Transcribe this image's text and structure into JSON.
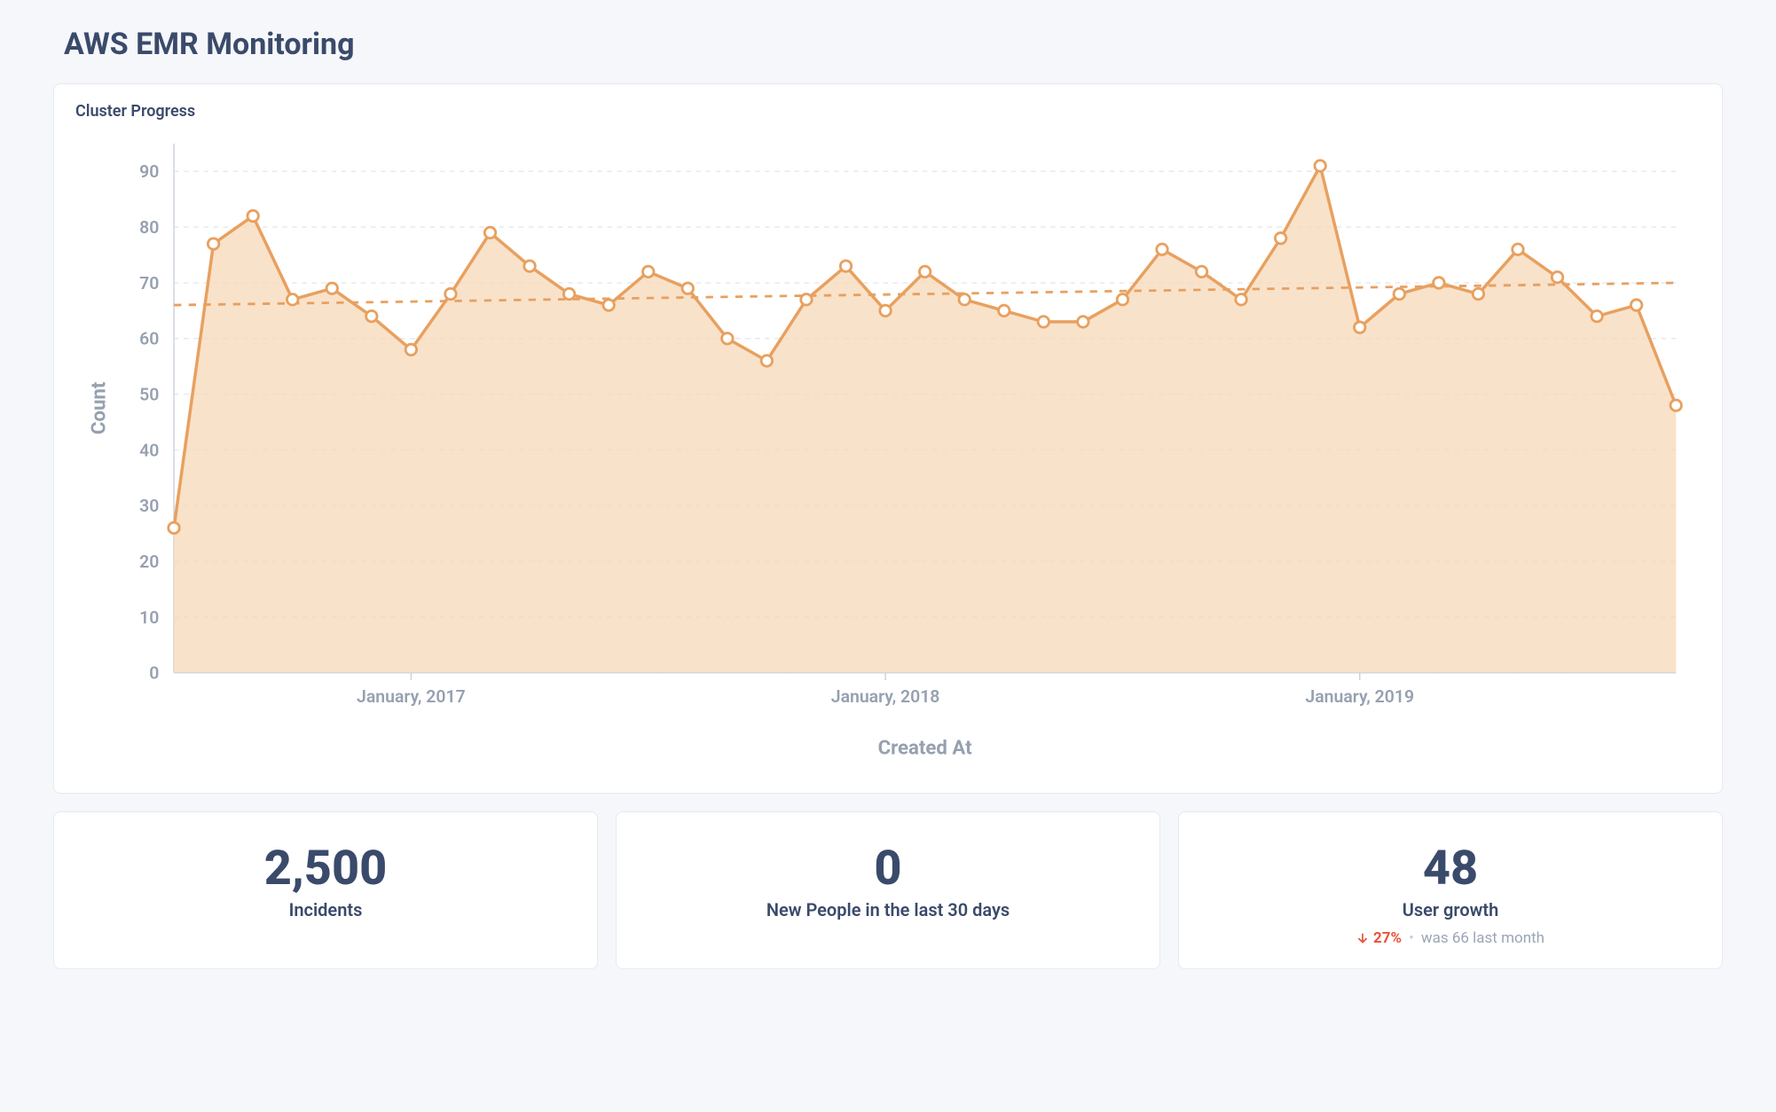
{
  "page": {
    "title": "AWS EMR Monitoring"
  },
  "chart": {
    "title": "Cluster Progress",
    "xlabel": "Created At",
    "ylabel": "Count",
    "xticks": [
      "January, 2017",
      "January, 2018",
      "January, 2019"
    ],
    "yticks": [
      "0",
      "10",
      "20",
      "30",
      "40",
      "50",
      "60",
      "70",
      "80",
      "90"
    ]
  },
  "stats": {
    "incidents": {
      "value": "2,500",
      "label": "Incidents"
    },
    "new_people": {
      "value": "0",
      "label": "New People in the last 30 days"
    },
    "user_growth": {
      "value": "48",
      "label": "User growth",
      "delta_pct": "27%",
      "delta_note_prefix": "was",
      "delta_prev": "66",
      "delta_note_suffix": "last month"
    }
  },
  "chart_data": {
    "type": "area",
    "title": "Cluster Progress",
    "xlabel": "Created At",
    "ylabel": "Count",
    "ylim": [
      0,
      95
    ],
    "x_tick_labels": [
      {
        "index": 6,
        "label": "January, 2017"
      },
      {
        "index": 18,
        "label": "January, 2018"
      },
      {
        "index": 30,
        "label": "January, 2019"
      }
    ],
    "values": [
      26,
      77,
      82,
      67,
      69,
      64,
      58,
      68,
      79,
      73,
      68,
      66,
      72,
      69,
      60,
      56,
      67,
      73,
      65,
      72,
      67,
      65,
      63,
      63,
      67,
      76,
      72,
      67,
      78,
      91,
      62,
      68,
      70,
      68,
      76,
      71,
      64,
      66,
      48
    ],
    "trend": {
      "start": 66,
      "end": 70
    }
  }
}
